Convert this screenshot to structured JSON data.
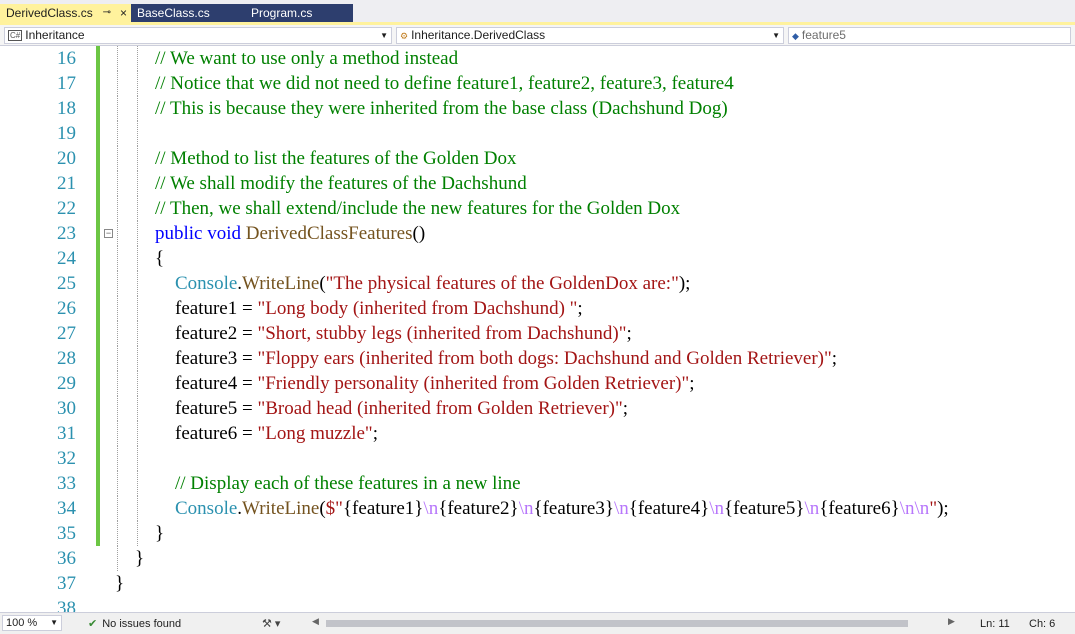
{
  "tabs": [
    {
      "label": "DerivedClass.cs",
      "active": true,
      "pin_glyph": "⊸",
      "close_glyph": "×"
    },
    {
      "label": "BaseClass.cs",
      "active": false
    },
    {
      "label": "Program.cs",
      "active": false
    }
  ],
  "navbar": {
    "project": "Inheritance",
    "project_icon": "C#",
    "class": "Inheritance.DerivedClass",
    "member": "feature5"
  },
  "editor": {
    "lines": [
      {
        "num": "16",
        "indent": 2,
        "tokens": [
          {
            "t": "// We want to use only a method instead",
            "c": "cmt"
          }
        ]
      },
      {
        "num": "17",
        "indent": 2,
        "tokens": [
          {
            "t": "// Notice that we did not need to define feature1, feature2, feature3, feature4",
            "c": "cmt"
          }
        ]
      },
      {
        "num": "18",
        "indent": 2,
        "tokens": [
          {
            "t": "// This is because they were inherited from the base class (Dachshund Dog)",
            "c": "cmt"
          }
        ]
      },
      {
        "num": "19",
        "indent": 2,
        "tokens": []
      },
      {
        "num": "20",
        "indent": 2,
        "tokens": [
          {
            "t": "// Method to list the features of the Golden Dox",
            "c": "cmt"
          }
        ]
      },
      {
        "num": "21",
        "indent": 2,
        "tokens": [
          {
            "t": "// We shall modify the features of the Dachshund",
            "c": "cmt"
          }
        ]
      },
      {
        "num": "22",
        "indent": 2,
        "tokens": [
          {
            "t": "// Then, we shall extend/include the new features for the Golden Dox",
            "c": "cmt"
          }
        ]
      },
      {
        "num": "23",
        "indent": 2,
        "collapse": true,
        "tokens": [
          {
            "t": "public",
            "c": "kw"
          },
          {
            "t": " ",
            "c": "plain"
          },
          {
            "t": "void",
            "c": "kw"
          },
          {
            "t": " ",
            "c": "plain"
          },
          {
            "t": "DerivedClassFeatures",
            "c": "meth"
          },
          {
            "t": "()",
            "c": "plain"
          }
        ]
      },
      {
        "num": "24",
        "indent": 2,
        "tokens": [
          {
            "t": "{",
            "c": "plain"
          }
        ]
      },
      {
        "num": "25",
        "indent": 3,
        "tokens": [
          {
            "t": "Console",
            "c": "type"
          },
          {
            "t": ".",
            "c": "plain"
          },
          {
            "t": "WriteLine",
            "c": "meth"
          },
          {
            "t": "(",
            "c": "plain"
          },
          {
            "t": "\"The physical features of the GoldenDox are:\"",
            "c": "str"
          },
          {
            "t": ");",
            "c": "plain"
          }
        ]
      },
      {
        "num": "26",
        "indent": 3,
        "tokens": [
          {
            "t": "feature1 = ",
            "c": "plain"
          },
          {
            "t": "\"Long body (inherited from Dachshund) \"",
            "c": "str"
          },
          {
            "t": ";",
            "c": "plain"
          }
        ]
      },
      {
        "num": "27",
        "indent": 3,
        "tokens": [
          {
            "t": "feature2 = ",
            "c": "plain"
          },
          {
            "t": "\"Short, stubby legs (inherited from Dachshund)\"",
            "c": "str"
          },
          {
            "t": ";",
            "c": "plain"
          }
        ]
      },
      {
        "num": "28",
        "indent": 3,
        "tokens": [
          {
            "t": "feature3 = ",
            "c": "plain"
          },
          {
            "t": "\"Floppy ears (inherited from both dogs: Dachshund and Golden Retriever)\"",
            "c": "str"
          },
          {
            "t": ";",
            "c": "plain"
          }
        ]
      },
      {
        "num": "29",
        "indent": 3,
        "tokens": [
          {
            "t": "feature4 = ",
            "c": "plain"
          },
          {
            "t": "\"Friendly personality (inherited from Golden Retriever)\"",
            "c": "str"
          },
          {
            "t": ";",
            "c": "plain"
          }
        ]
      },
      {
        "num": "30",
        "indent": 3,
        "tokens": [
          {
            "t": "feature5 = ",
            "c": "plain"
          },
          {
            "t": "\"Broad head (inherited from Golden Retriever)\"",
            "c": "str"
          },
          {
            "t": ";",
            "c": "plain"
          }
        ]
      },
      {
        "num": "31",
        "indent": 3,
        "tokens": [
          {
            "t": "feature6 = ",
            "c": "plain"
          },
          {
            "t": "\"Long muzzle\"",
            "c": "str"
          },
          {
            "t": ";",
            "c": "plain"
          }
        ]
      },
      {
        "num": "32",
        "indent": 3,
        "tokens": []
      },
      {
        "num": "33",
        "indent": 3,
        "tokens": [
          {
            "t": "// Display each of these features in a new line",
            "c": "cmt"
          }
        ]
      },
      {
        "num": "34",
        "indent": 3,
        "tokens": [
          {
            "t": "Console",
            "c": "type"
          },
          {
            "t": ".",
            "c": "plain"
          },
          {
            "t": "WriteLine",
            "c": "meth"
          },
          {
            "t": "(",
            "c": "plain"
          },
          {
            "t": "$\"",
            "c": "str"
          },
          {
            "t": "{feature1}",
            "c": "plain"
          },
          {
            "t": "\\n",
            "c": "esc"
          },
          {
            "t": "{feature2}",
            "c": "plain"
          },
          {
            "t": "\\n",
            "c": "esc"
          },
          {
            "t": "{feature3}",
            "c": "plain"
          },
          {
            "t": "\\n",
            "c": "esc"
          },
          {
            "t": "{feature4}",
            "c": "plain"
          },
          {
            "t": "\\n",
            "c": "esc"
          },
          {
            "t": "{feature5}",
            "c": "plain"
          },
          {
            "t": "\\n",
            "c": "esc"
          },
          {
            "t": "{feature6}",
            "c": "plain"
          },
          {
            "t": "\\n\\n",
            "c": "esc"
          },
          {
            "t": "\"",
            "c": "str"
          },
          {
            "t": ");",
            "c": "plain"
          }
        ]
      },
      {
        "num": "35",
        "indent": 2,
        "tokens": [
          {
            "t": "}",
            "c": "plain"
          }
        ]
      },
      {
        "num": "36",
        "indent": 1,
        "tokens": [
          {
            "t": "}",
            "c": "plain"
          }
        ]
      },
      {
        "num": "37",
        "indent": 0,
        "tokens": [
          {
            "t": "}",
            "c": "plain"
          }
        ]
      },
      {
        "num": "38",
        "indent": 0,
        "tokens": []
      }
    ]
  },
  "status": {
    "zoom": "100 %",
    "issues": "No issues found",
    "issues_icon": "✔",
    "brush_icon": "⚒ ▾",
    "ln": "Ln: 11",
    "ch": "Ch: 6"
  },
  "colors": {
    "comment": "#008000",
    "keyword": "#0000ff",
    "type": "#2b91af",
    "string": "#a31515",
    "escape": "#b776fb",
    "method": "#74531f",
    "change_mark": "#6cc644",
    "active_tab": "#fff29d",
    "inactive_tab": "#2d3e6e"
  }
}
